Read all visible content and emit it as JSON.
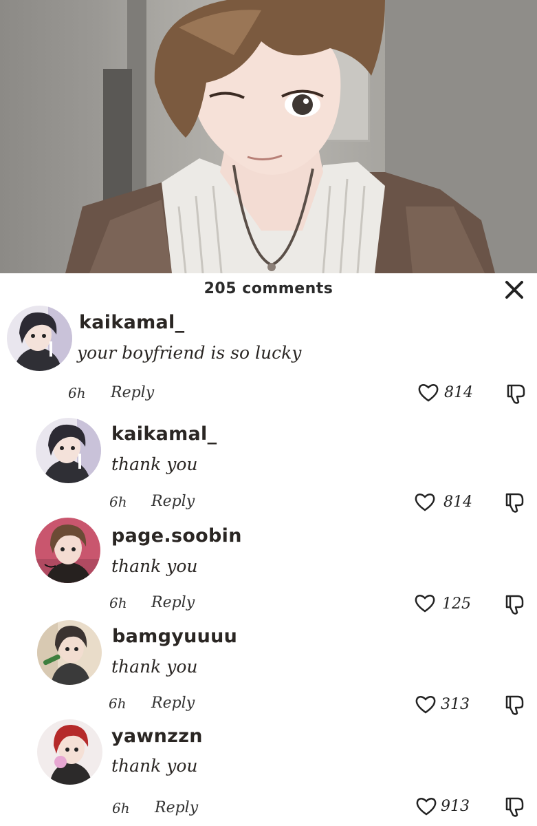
{
  "header": {
    "comment_count": "205 comments",
    "close_icon": "close-icon"
  },
  "comments": [
    {
      "username": "kaikamal_",
      "text": "your boyfriend is so lucky",
      "time": "6h",
      "reply_label": "Reply",
      "likes": "814",
      "avatar_icon": "avatar-dark-hair"
    },
    {
      "username": "kaikamal_",
      "text": "thank you",
      "time": "6h",
      "reply_label": "Reply",
      "likes": "814",
      "avatar_icon": "avatar-dark-hair"
    },
    {
      "username": "page.soobin",
      "text": "thank you",
      "time": "6h",
      "reply_label": "Reply",
      "likes": "125",
      "avatar_icon": "avatar-brown-hair"
    },
    {
      "username": "bamgyuuuu",
      "text": "thank you",
      "time": "6h",
      "reply_label": "Reply",
      "likes": "313",
      "avatar_icon": "avatar-microphone"
    },
    {
      "username": "yawnzzn",
      "text": "thank you",
      "time": "6h",
      "reply_label": "Reply",
      "likes": "913",
      "avatar_icon": "avatar-red-hair"
    }
  ],
  "colors": {
    "text": "#2a2623",
    "background": "#ffffff"
  }
}
